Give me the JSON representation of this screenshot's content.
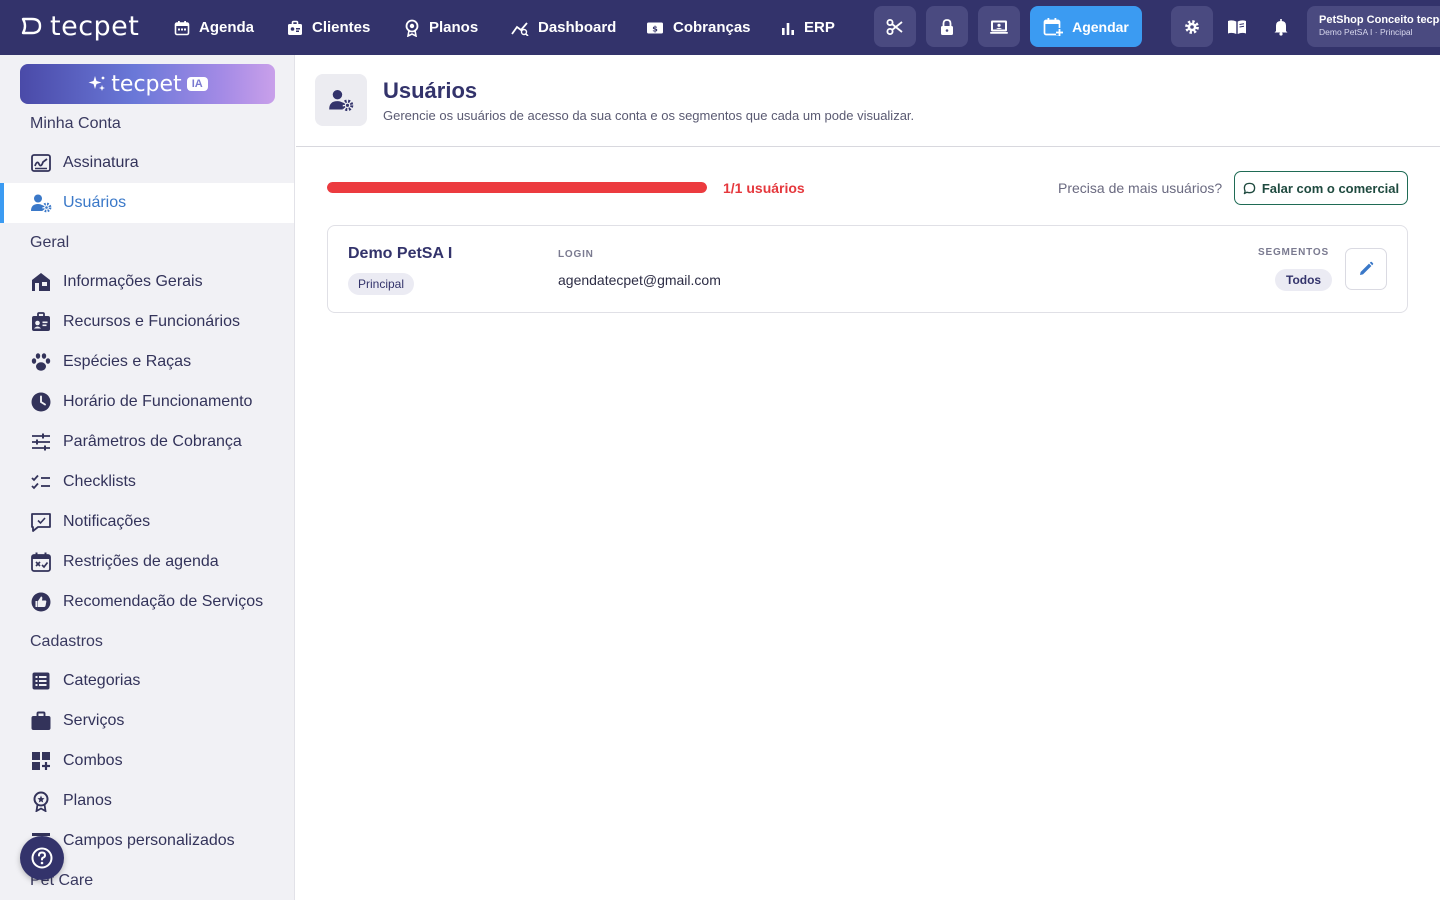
{
  "brand": {
    "logo_text": "tecpet"
  },
  "topnav": {
    "items": [
      {
        "label": "Agenda",
        "icon": "calendar-icon"
      },
      {
        "label": "Clientes",
        "icon": "clients-icon"
      },
      {
        "label": "Planos",
        "icon": "award-icon"
      },
      {
        "label": "Dashboard",
        "icon": "chart-line-icon"
      },
      {
        "label": "Cobranças",
        "icon": "money-icon"
      },
      {
        "label": "ERP",
        "icon": "bar-chart-icon"
      }
    ],
    "tools": [
      "scissors-icon",
      "lock-icon",
      "screen-icon"
    ],
    "agendar_label": "Agendar",
    "account": {
      "name": "PetShop Conceito tecpet",
      "subtitle": "Demo PetSA I · Principal"
    }
  },
  "sidebar": {
    "ia_text": "tecpet",
    "ia_badge": "IA",
    "sections": [
      {
        "title": "Minha Conta",
        "items": [
          {
            "label": "Assinatura",
            "icon": "signature-icon"
          },
          {
            "label": "Usuários",
            "icon": "user-gear-icon",
            "active": true
          }
        ]
      },
      {
        "title": "Geral",
        "items": [
          {
            "label": "Informações Gerais",
            "icon": "store-icon"
          },
          {
            "label": "Recursos e Funcionários",
            "icon": "id-badge-icon"
          },
          {
            "label": "Espécies e Raças",
            "icon": "paw-icon"
          },
          {
            "label": "Horário de Funcionamento",
            "icon": "clock-icon"
          },
          {
            "label": "Parâmetros de Cobrança",
            "icon": "sliders-icon"
          },
          {
            "label": "Checklists",
            "icon": "checklist-icon"
          },
          {
            "label": "Notificações",
            "icon": "notification-icon"
          },
          {
            "label": "Restrições de agenda",
            "icon": "calendar-restriction-icon"
          },
          {
            "label": "Recomendação de Serviços",
            "icon": "recommend-icon"
          }
        ]
      },
      {
        "title": "Cadastros",
        "items": [
          {
            "label": "Categorias",
            "icon": "list-icon"
          },
          {
            "label": "Serviços",
            "icon": "briefcase-icon"
          },
          {
            "label": "Combos",
            "icon": "combo-icon"
          },
          {
            "label": "Planos",
            "icon": "award-icon"
          },
          {
            "label": "Campos personalizados",
            "icon": "form-icon"
          }
        ]
      },
      {
        "title": "Pet Care",
        "items": []
      }
    ]
  },
  "page": {
    "title": "Usuários",
    "subtitle": "Gerencie os usuários de acesso da sua conta e os segmentos que cada um pode visualizar."
  },
  "usage": {
    "label": "1/1 usuários",
    "fill_percent": 100,
    "more_users_text": "Precisa de mais usuários?",
    "contact_button": "Falar com o comercial"
  },
  "users": [
    {
      "name": "Demo PetSA I",
      "role": "Principal",
      "login_label": "LOGIN",
      "login": "agendatecpet@gmail.com",
      "segments_label": "SEGMENTOS",
      "segments": "Todos"
    }
  ],
  "colors": {
    "topbar": "#33336b",
    "accent": "#3b9bf2",
    "danger": "#ec3b3f",
    "sidebar_bg": "#f1f1f5"
  }
}
